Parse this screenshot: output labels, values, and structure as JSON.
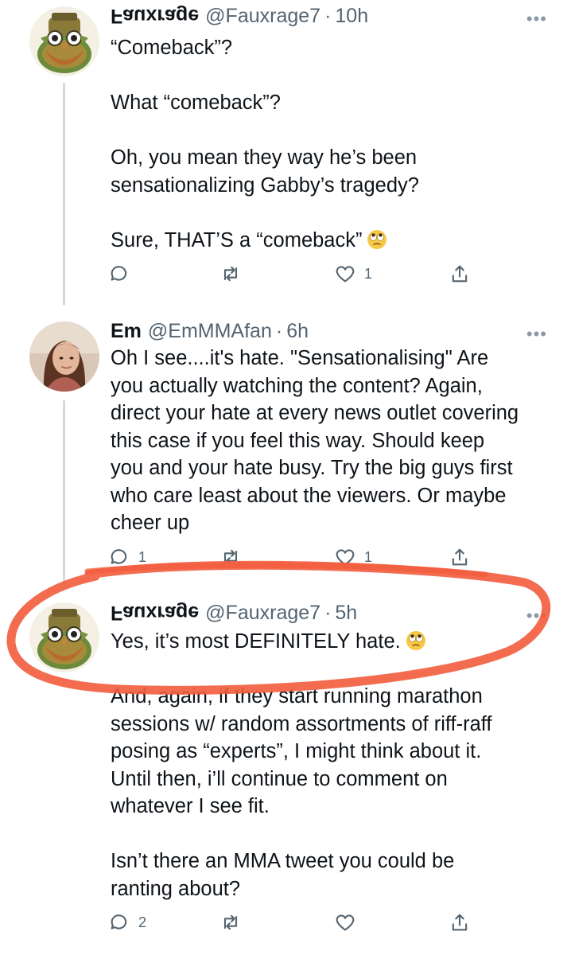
{
  "thread": {
    "tweets": [
      {
        "display_name": "Fauxrage",
        "handle": "@Fauxrage7",
        "separator": "·",
        "time": "10h",
        "body": {
          "line1": "“Comeback”?",
          "line2": "What “comeback”?",
          "line3": "Oh, you mean they way he’s been",
          "line4": "sensationalizing Gabby’s tragedy?",
          "line5": "Sure, THAT’S a “comeback”"
        },
        "stats": {
          "replies": "",
          "retweets": "",
          "likes": "1"
        },
        "emoji": "face-with-rolling-eyes"
      },
      {
        "display_name": "Em",
        "handle": "@EmMMAfan",
        "separator": "·",
        "time": "6h",
        "body": {
          "line1": "Oh I see....it's hate. \"Sensationalising\" Are",
          "line2": "you actually watching the content? Again,",
          "line3": "direct your hate at every news outlet covering",
          "line4": "this case if you feel this way. Should keep",
          "line5": "you and your hate busy. Try the big guys first",
          "line6": "who care least about the viewers. Or maybe",
          "line7": "cheer up"
        },
        "stats": {
          "replies": "1",
          "retweets": "",
          "likes": "1"
        }
      },
      {
        "display_name": "Fauxrage",
        "handle": "@Fauxrage7",
        "separator": "·",
        "time": "5h",
        "body": {
          "line1": "Yes, it’s most DEFINITELY hate.",
          "line2": "And, again, if they start running marathon",
          "line3": "sessions w/ random assortments of riff-raff",
          "line4": "posing as “experts”, I might think about it.",
          "line5": "Until then, i’ll continue to comment on",
          "line6": "whatever I see fit.",
          "line7": "Isn’t there an MMA tweet you could be",
          "line8": "ranting about?"
        },
        "stats": {
          "replies": "2",
          "retweets": "",
          "likes": ""
        },
        "emoji": "face-with-rolling-eyes"
      }
    ]
  },
  "icons": {
    "reply": "reply-icon",
    "retweet": "retweet-icon",
    "like": "heart-icon",
    "share": "share-icon",
    "more": "more-icon"
  },
  "colors": {
    "annotation_stroke": "#f25c3d",
    "secondary_text": "#536471",
    "thread_line": "#cfd9de"
  }
}
